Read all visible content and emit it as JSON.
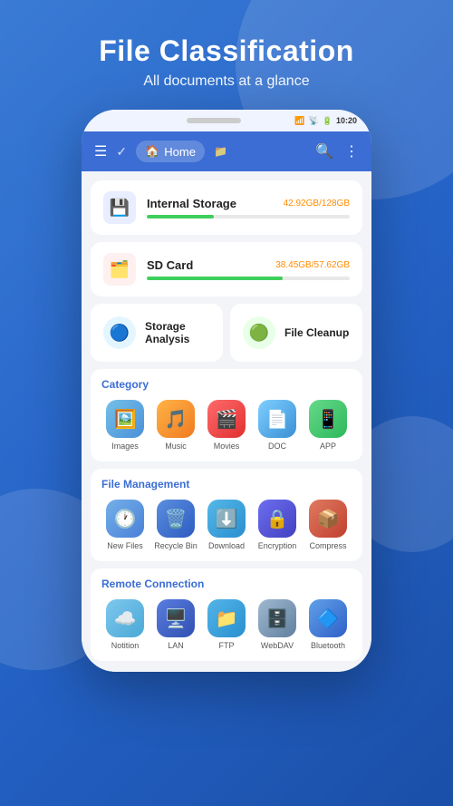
{
  "header": {
    "title": "File Classification",
    "subtitle": "All documents at a glance"
  },
  "status_bar": {
    "time": "10:20",
    "wifi": "wifi",
    "signal": "signal",
    "battery": "battery"
  },
  "toolbar": {
    "home_label": "Home",
    "search_label": "search",
    "more_label": "more"
  },
  "storage": [
    {
      "name": "Internal Storage",
      "used": "42.92GB",
      "total": "128GB",
      "percent": 33,
      "icon": "💾",
      "icon_class": "storage-icon-internal"
    },
    {
      "name": "SD Card",
      "used": "38.45GB",
      "total": "57.62GB",
      "percent": 67,
      "icon": "🗂️",
      "icon_class": "storage-icon-sd"
    }
  ],
  "quick_actions": [
    {
      "label": "Storage Analysis",
      "icon": "🔵",
      "icon_class": "qa-icon-analysis"
    },
    {
      "label": "File Cleanup",
      "icon": "🟢",
      "icon_class": "qa-icon-cleanup"
    }
  ],
  "category": {
    "title": "Category",
    "items": [
      {
        "label": "Images",
        "icon": "🖼️",
        "icon_class": "ic-images"
      },
      {
        "label": "Music",
        "icon": "🎵",
        "icon_class": "ic-music"
      },
      {
        "label": "Movies",
        "icon": "🎬",
        "icon_class": "ic-movies"
      },
      {
        "label": "DOC",
        "icon": "📄",
        "icon_class": "ic-doc"
      },
      {
        "label": "APP",
        "icon": "📱",
        "icon_class": "ic-app"
      }
    ]
  },
  "file_management": {
    "title": "File Management",
    "items": [
      {
        "label": "New Files",
        "icon": "🕐",
        "icon_class": "ic-newfiles"
      },
      {
        "label": "Recycle Bin",
        "icon": "🗑️",
        "icon_class": "ic-recycle"
      },
      {
        "label": "Download",
        "icon": "⬇️",
        "icon_class": "ic-download"
      },
      {
        "label": "Encryption",
        "icon": "🔒",
        "icon_class": "ic-encrypt"
      },
      {
        "label": "Compress",
        "icon": "📦",
        "icon_class": "ic-compress"
      }
    ]
  },
  "remote_connection": {
    "title": "Remote Connection",
    "items": [
      {
        "label": "Notition",
        "icon": "☁️",
        "icon_class": "ic-notion"
      },
      {
        "label": "LAN",
        "icon": "🖥️",
        "icon_class": "ic-lan"
      },
      {
        "label": "FTP",
        "icon": "📁",
        "icon_class": "ic-ftp"
      },
      {
        "label": "WebDAV",
        "icon": "🗄️",
        "icon_class": "ic-webdav"
      },
      {
        "label": "Bluetooth",
        "icon": "🔷",
        "icon_class": "ic-bluetooth"
      }
    ]
  }
}
